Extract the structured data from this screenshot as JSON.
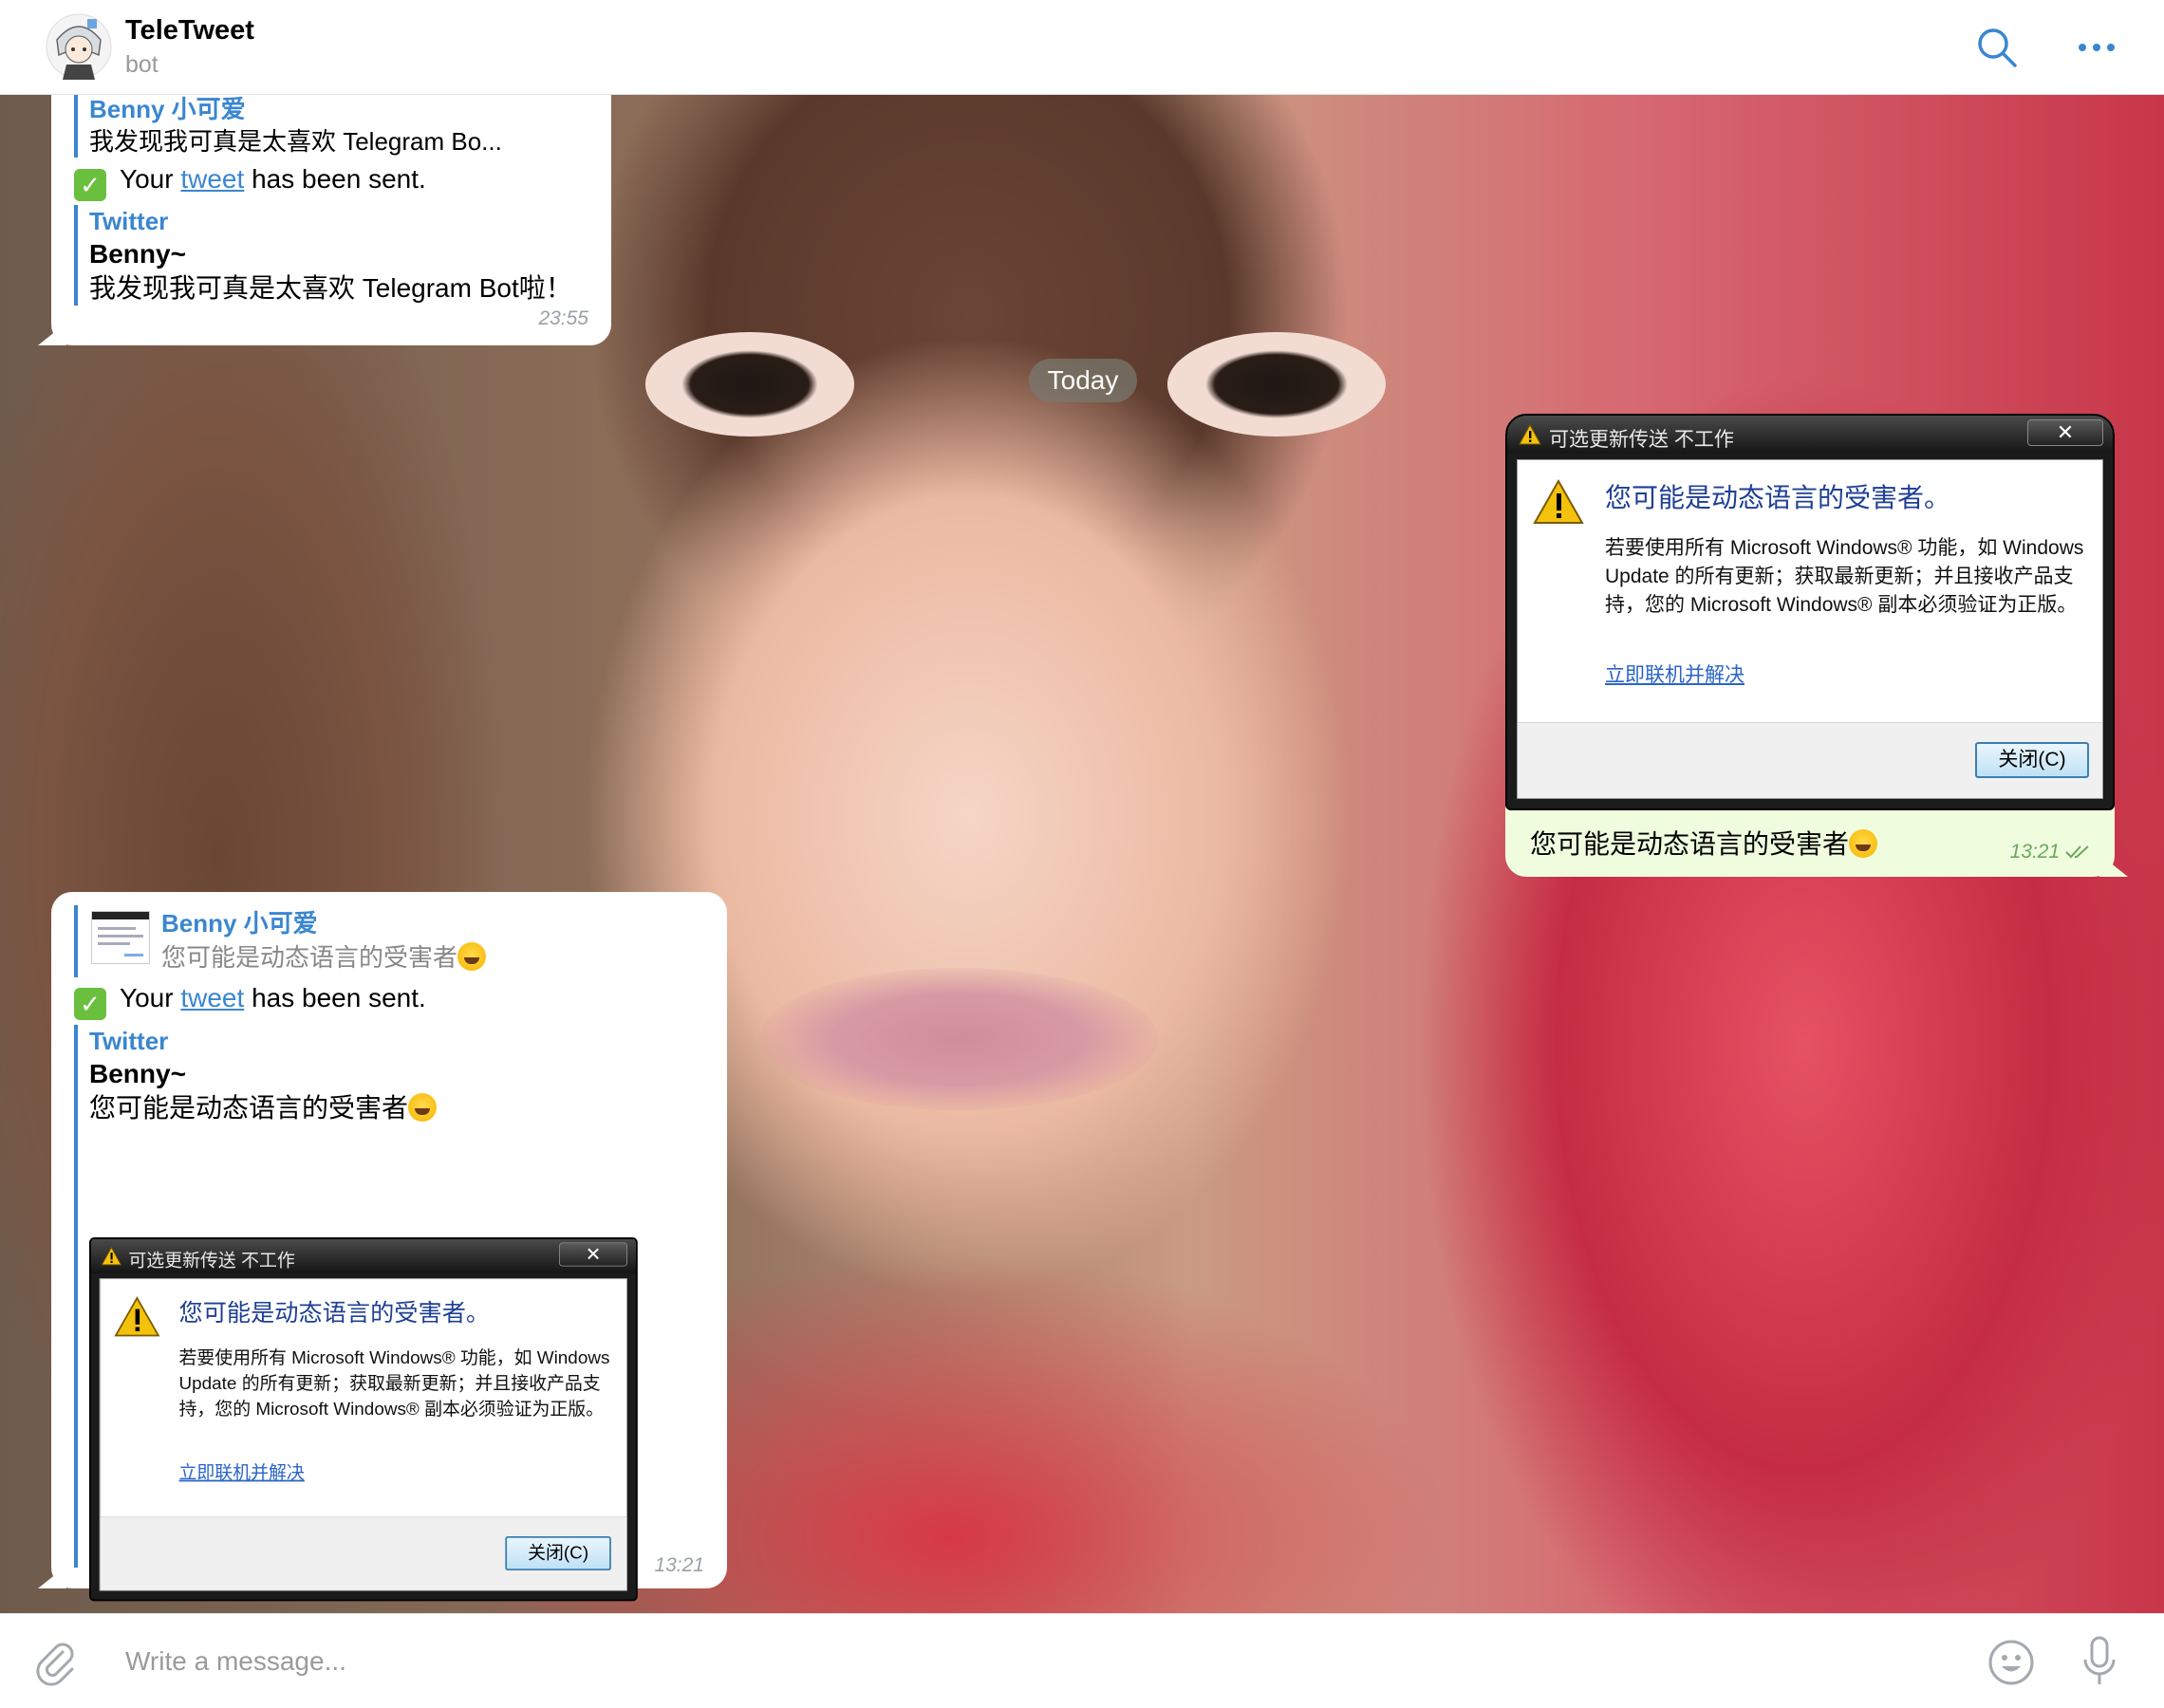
{
  "header": {
    "title": "TeleTweet",
    "subtitle": "bot",
    "search_icon": "search-icon",
    "more_icon": "more-icon"
  },
  "date_separator": "Today",
  "messages": [
    {
      "reply_to": {
        "name": "Benny 小可爱",
        "text": "我发现我可真是太喜欢 Telegram Bo..."
      },
      "sent": {
        "prefix": "Your",
        "link": "tweet",
        "suffix": "has been sent."
      },
      "tweet": {
        "source": "Twitter",
        "author": "Benny~",
        "text": "我发现我可真是太喜欢 Telegram Bot啦！"
      },
      "time": "23:55"
    },
    {
      "text": "您可能是动态语言的受害者",
      "time": "13:21"
    },
    {
      "reply_to": {
        "name": "Benny 小可爱",
        "text": "您可能是动态语言的受害者"
      },
      "sent": {
        "prefix": "Your",
        "link": "tweet",
        "suffix": "has been sent."
      },
      "tweet": {
        "source": "Twitter",
        "author": "Benny~",
        "text": "您可能是动态语言的受害者"
      },
      "time": "13:21"
    }
  ],
  "dialog": {
    "title": "可选更新传送 不工作",
    "close_x": "✕",
    "heading": "您可能是动态语言的受害者。",
    "body": "若要使用所有 Microsoft Windows® 功能，如 Windows Update 的所有更新；获取最新更新；并且接收产品支持，您的 Microsoft Windows® 副本必须验证为正版。",
    "link": "立即联机并解决",
    "button": "关闭(C)"
  },
  "composer": {
    "placeholder": "Write a message..."
  },
  "colors": {
    "accent": "#3a86d0",
    "outgoing_bubble": "#effdde",
    "check_green": "#6bbf3f"
  }
}
